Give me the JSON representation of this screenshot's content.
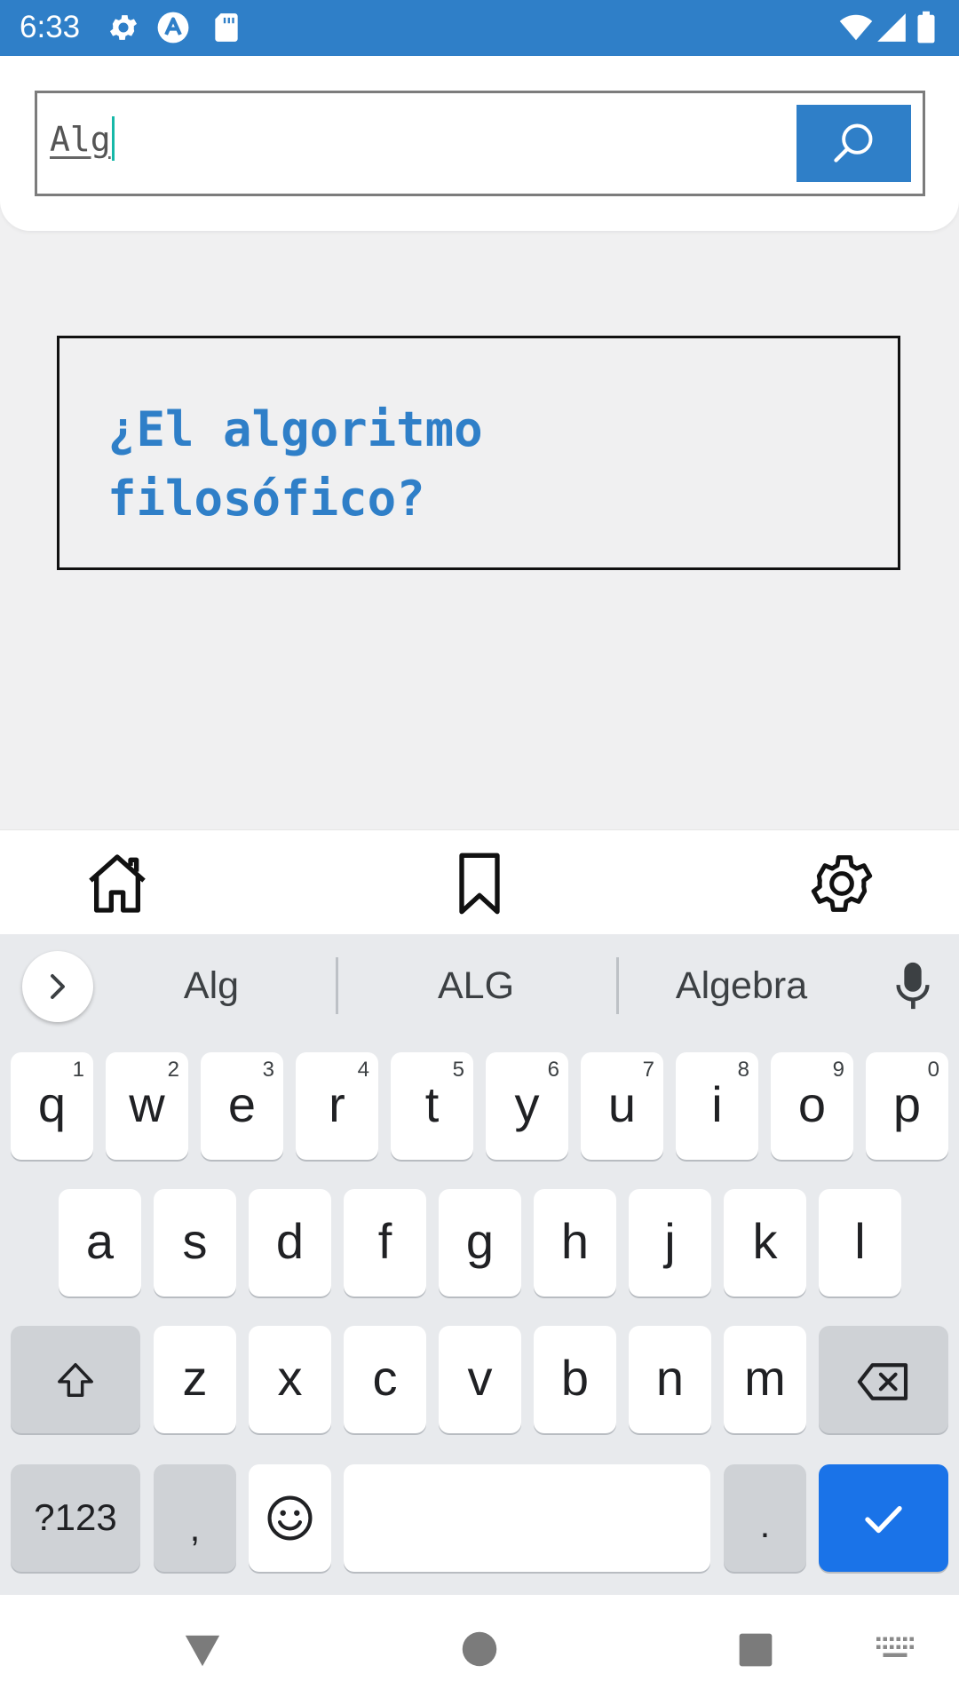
{
  "status_bar": {
    "time": "6:33",
    "bg_color": "#2f7fc8"
  },
  "search": {
    "value": "Alg",
    "accent": "#2f7fc8"
  },
  "card": {
    "text_line1": "¿El algoritmo",
    "text_line2": "filosófico?",
    "text_color": "#2f7fc8"
  },
  "bottom_nav": {
    "items": [
      "home-icon",
      "bookmark-icon",
      "gear-icon"
    ]
  },
  "keyboard": {
    "suggestions": [
      "Alg",
      "ALG",
      "Algebra"
    ],
    "row1": [
      {
        "ch": "q",
        "hint": "1"
      },
      {
        "ch": "w",
        "hint": "2"
      },
      {
        "ch": "e",
        "hint": "3"
      },
      {
        "ch": "r",
        "hint": "4"
      },
      {
        "ch": "t",
        "hint": "5"
      },
      {
        "ch": "y",
        "hint": "6"
      },
      {
        "ch": "u",
        "hint": "7"
      },
      {
        "ch": "i",
        "hint": "8"
      },
      {
        "ch": "o",
        "hint": "9"
      },
      {
        "ch": "p",
        "hint": "0"
      }
    ],
    "row2": [
      "a",
      "s",
      "d",
      "f",
      "g",
      "h",
      "j",
      "k",
      "l"
    ],
    "row3": [
      "z",
      "x",
      "c",
      "v",
      "b",
      "n",
      "m"
    ],
    "symbols_label": "?123",
    "comma_label": ",",
    "period_label": ".",
    "enter_color": "#1a73e8"
  }
}
